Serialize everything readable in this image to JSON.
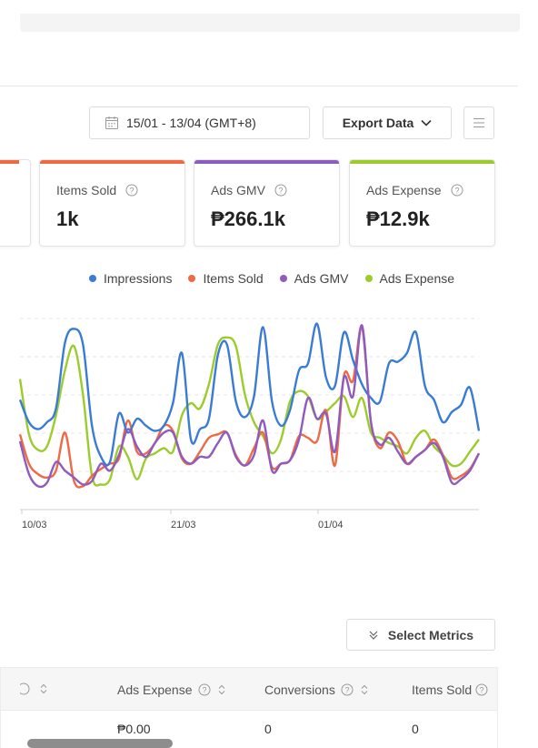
{
  "toolbar": {
    "date_range": "15/01 - 13/04 (GMT+8)",
    "export_label": "Export Data"
  },
  "cards": [
    {
      "label": "Items Sold",
      "value": "1k",
      "color": "#ee6a45"
    },
    {
      "label": "Ads GMV",
      "value": "₱266.1k",
      "color": "#8e5bbf"
    },
    {
      "label": "Ads Expense",
      "value": "₱12.9k",
      "color": "#9ccc2c"
    }
  ],
  "legend": [
    {
      "name": "Impressions",
      "color": "#3a7bd5"
    },
    {
      "name": "Items Sold",
      "color": "#ee6a45"
    },
    {
      "name": "Ads GMV",
      "color": "#8e5bbf"
    },
    {
      "name": "Ads Expense",
      "color": "#9ccc2c"
    }
  ],
  "chart_data": {
    "type": "line",
    "x_ticks": [
      "10/03",
      "21/03",
      "01/04"
    ],
    "grid": true,
    "legend_placement": "top-right",
    "series": [
      {
        "name": "Impressions",
        "color": "#3a7bd5",
        "values": [
          0.53,
          0.4,
          0.36,
          0.4,
          0.48,
          0.86,
          0.94,
          0.85,
          0.38,
          0.2,
          0.17,
          0.45,
          0.34,
          0.42,
          0.38,
          0.35,
          0.38,
          0.51,
          0.8,
          0.3,
          0.36,
          0.42,
          0.79,
          0.85,
          0.52,
          0.43,
          0.55,
          0.95,
          0.52,
          0.38,
          0.47,
          0.7,
          0.74,
          0.97,
          0.66,
          0.61,
          0.92,
          0.76,
          0.62,
          0.54,
          0.52,
          0.74,
          0.75,
          0.8,
          0.92,
          0.61,
          0.53,
          0.4,
          0.46,
          0.5,
          0.6,
          0.35
        ]
      },
      {
        "name": "Items Sold",
        "color": "#ee6a45",
        "values": [
          0.33,
          0.16,
          0.1,
          0.08,
          0.12,
          0.34,
          0.06,
          0.03,
          0.09,
          0.13,
          0.16,
          0.19,
          0.41,
          0.23,
          0.22,
          0.28,
          0.38,
          0.35,
          0.19,
          0.16,
          0.23,
          0.31,
          0.33,
          0.34,
          0.21,
          0.15,
          0.25,
          0.34,
          0.14,
          0.16,
          0.18,
          0.32,
          0.31,
          0.29,
          0.47,
          0.15,
          0.67,
          0.64,
          0.95,
          0.4,
          0.25,
          0.34,
          0.29,
          0.16,
          0.2,
          0.24,
          0.3,
          0.21,
          0.08,
          0.09,
          0.13,
          0.22
        ]
      },
      {
        "name": "Ads GMV",
        "color": "#8e5bbf",
        "values": [
          0.29,
          0.1,
          0.03,
          0.05,
          0.17,
          0.12,
          0.08,
          0.04,
          0.06,
          0.16,
          0.12,
          0.21,
          0.36,
          0.26,
          0.2,
          0.28,
          0.34,
          0.34,
          0.2,
          0.16,
          0.2,
          0.2,
          0.28,
          0.34,
          0.2,
          0.15,
          0.21,
          0.41,
          0.12,
          0.16,
          0.18,
          0.3,
          0.54,
          0.42,
          0.45,
          0.23,
          0.66,
          0.55,
          0.96,
          0.4,
          0.27,
          0.31,
          0.23,
          0.16,
          0.2,
          0.24,
          0.28,
          0.2,
          0.05,
          0.07,
          0.12,
          0.22
        ]
      },
      {
        "name": "Ads Expense",
        "color": "#9ccc2c",
        "values": [
          0.65,
          0.33,
          0.24,
          0.26,
          0.44,
          0.7,
          0.84,
          0.56,
          0.09,
          0.04,
          0.07,
          0.26,
          0.2,
          0.07,
          0.19,
          0.22,
          0.25,
          0.23,
          0.44,
          0.51,
          0.48,
          0.62,
          0.85,
          0.89,
          0.84,
          0.56,
          0.4,
          0.32,
          0.22,
          0.3,
          0.52,
          0.58,
          0.55,
          0.42,
          0.46,
          0.51,
          0.55,
          0.43,
          0.54,
          0.34,
          0.31,
          0.28,
          0.26,
          0.22,
          0.31,
          0.35,
          0.26,
          0.21,
          0.15,
          0.16,
          0.23,
          0.3
        ]
      }
    ]
  },
  "select_metrics_label": "Select Metrics",
  "table": {
    "headers": [
      "Ads Expense",
      "Conversions",
      "Items Sold"
    ],
    "row": [
      "₱0.00",
      "0",
      "0"
    ]
  }
}
